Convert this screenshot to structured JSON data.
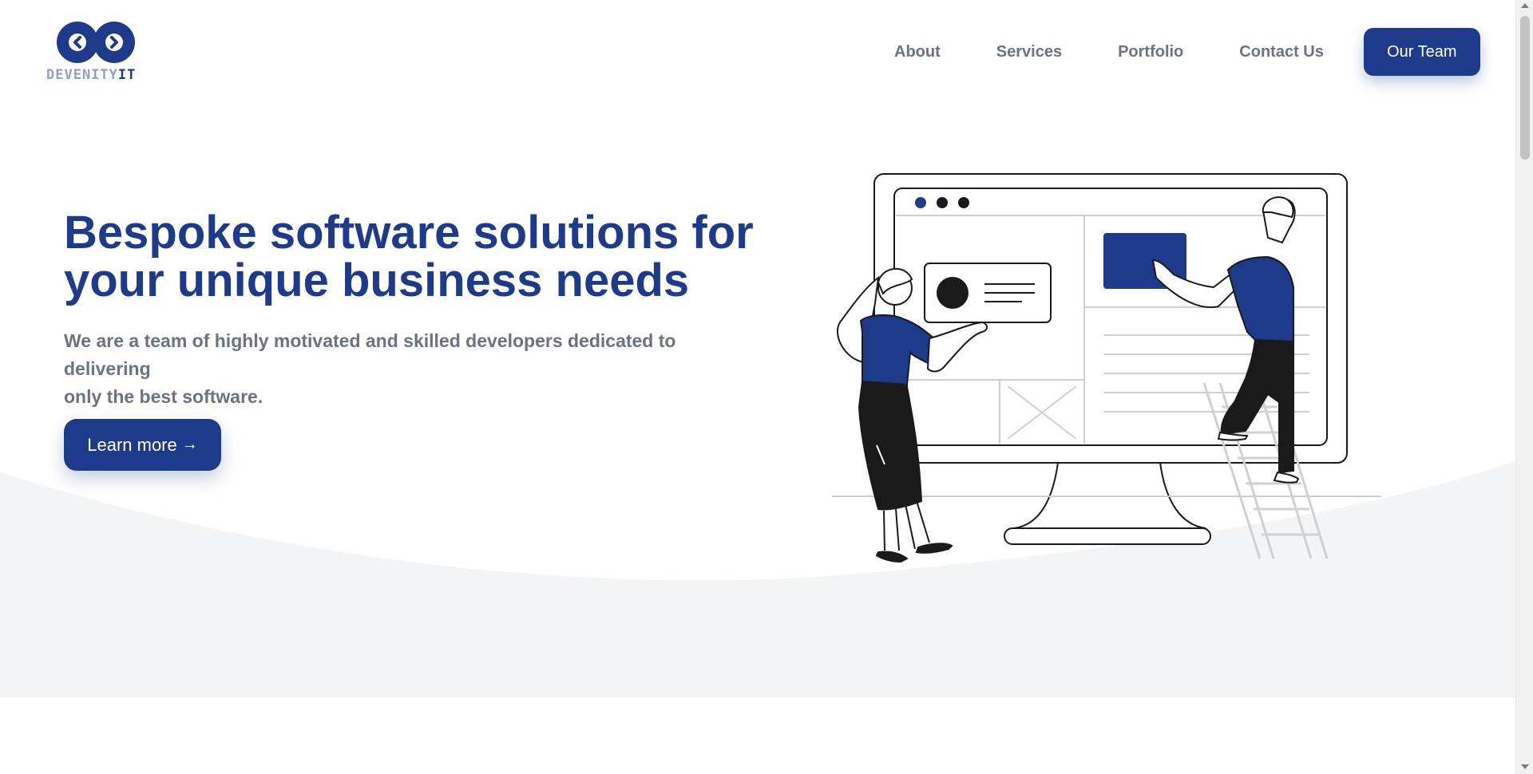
{
  "header": {
    "logo": {
      "text_part1": "DEVENITY",
      "text_part2": "IT",
      "icon": "infinity-arrows-logo-icon"
    },
    "nav": [
      {
        "label": "About"
      },
      {
        "label": "Services"
      },
      {
        "label": "Portfolio"
      },
      {
        "label": "Contact Us"
      }
    ],
    "cta_label": "Our Team"
  },
  "hero": {
    "title_line1": "Bespoke software solutions for",
    "title_line2": "your unique business needs",
    "subtitle_line1": "We are a team of highly motivated and skilled developers dedicated to delivering",
    "subtitle_line2": "only the best software.",
    "button_label": "Learn more",
    "button_icon": "arrow-right-icon",
    "illustration": "team-building-website-illustration"
  },
  "colors": {
    "brand": "#1e3a8a",
    "text_muted": "#6b7280",
    "logo_light": "#8d9fcf",
    "section_bg": "#f3f4f6"
  }
}
